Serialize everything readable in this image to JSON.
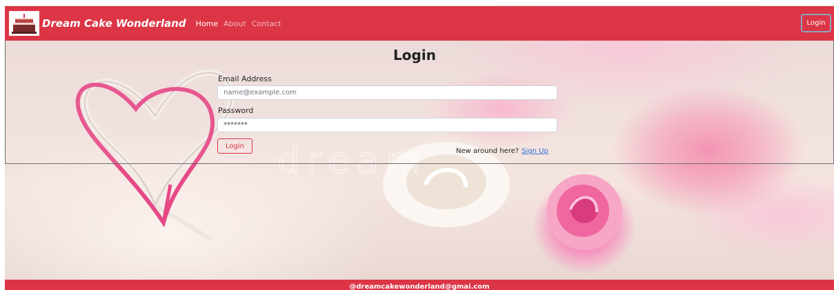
{
  "colors": {
    "brand": "#dc3545",
    "link": "#2f6bd8"
  },
  "navbar": {
    "brand_name": "Dream Cake Wonderland",
    "logo_icon": "cake-icon",
    "links": [
      {
        "label": "Home",
        "active": true
      },
      {
        "label": "About",
        "active": false
      },
      {
        "label": "Contact",
        "active": false
      }
    ],
    "login_button": "Login"
  },
  "login_form": {
    "title": "Login",
    "email": {
      "label": "Email Address",
      "placeholder": "name@example.com",
      "value": ""
    },
    "password": {
      "label": "Password",
      "value": "*******"
    },
    "submit_label": "Login",
    "signup_prompt": "New around here?",
    "signup_link": "Sign Up"
  },
  "background": {
    "watermark": "dream"
  },
  "footer": {
    "text": "@dreamcakewonderland@gmai.com"
  }
}
